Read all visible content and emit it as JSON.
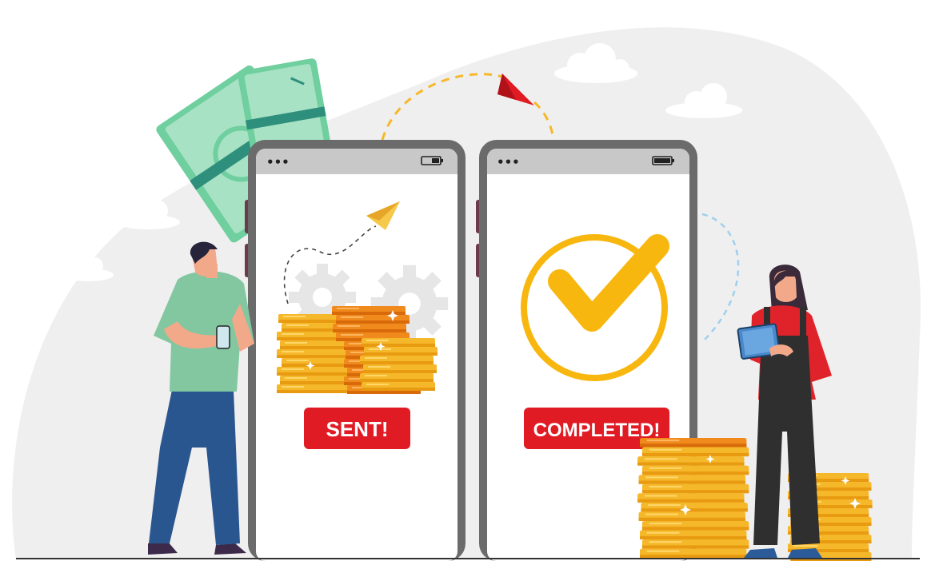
{
  "left_phone": {
    "status": {
      "menu_dots": "•••",
      "battery_icon": "battery-low-icon"
    },
    "badge_label": "SENT!",
    "icons": [
      "paper-plane-icon",
      "gear-icon",
      "gear-icon",
      "coin-stack-icon"
    ]
  },
  "right_phone": {
    "status": {
      "menu_dots": "•••",
      "battery_icon": "battery-full-icon"
    },
    "badge_label": "COMPLETED!",
    "icons": [
      "checkmark-circle-icon"
    ]
  },
  "colors": {
    "background_blob": "#efefef",
    "phone_frame": "#6b6b6b",
    "status_bar": "#c8c8c8",
    "badge_red": "#e01b24",
    "coin_gold": "#f6b82b",
    "coin_orange": "#f08a1c",
    "check_yellow": "#f8b70f",
    "banknote_green": "#a8e2c4",
    "banknote_band": "#2e8f7c"
  }
}
